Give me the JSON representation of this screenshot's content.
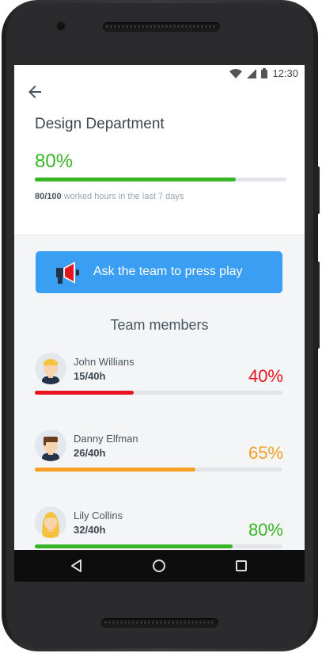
{
  "status": {
    "time": "12:30"
  },
  "header": {
    "title": "Design Department",
    "progress_percent": "80%",
    "progress_fraction": 0.8,
    "hours_done": "80/100",
    "hours_caption": "worked hours in the last 7 days"
  },
  "cta": {
    "label": "Ask the team to press play"
  },
  "team": {
    "title": "Team members",
    "members": [
      {
        "name": "John Willians",
        "hours": "15/40h",
        "percent": "40%",
        "fraction": 0.4,
        "color": "#e8141e"
      },
      {
        "name": "Danny Elfman",
        "hours": "26/40h",
        "percent": "65%",
        "fraction": 0.65,
        "color": "#f5a020"
      },
      {
        "name": "Lily Collins",
        "hours": "32/40h",
        "percent": "80%",
        "fraction": 0.8,
        "color": "#38b426"
      }
    ]
  },
  "colors": {
    "accent": "#3a9ef2",
    "success": "#38b426",
    "warning": "#f5a020",
    "danger": "#e8141e"
  },
  "icons": {
    "back": "arrow-left-icon",
    "cta": "megaphone-icon",
    "nav": [
      "back-triangle-icon",
      "home-circle-icon",
      "recents-square-icon"
    ]
  }
}
